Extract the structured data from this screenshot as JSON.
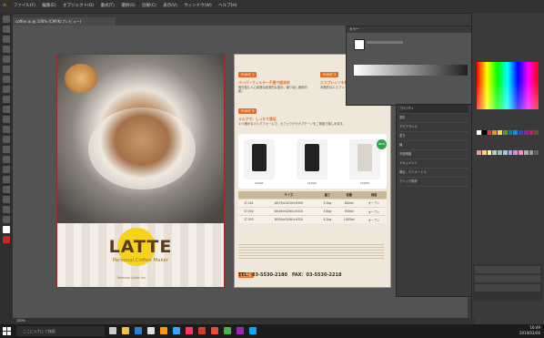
{
  "menubar": {
    "items": [
      "ファイル(F)",
      "編集(E)",
      "オブジェクト(O)",
      "書式(T)",
      "選択(S)",
      "効果(C)",
      "表示(V)",
      "ウィンドウ(W)",
      "ヘルプ(H)"
    ]
  },
  "document": {
    "tab_label": "coffee.ai @ 100% (CMYK/プレビュー)"
  },
  "page1": {
    "title": "LATTE",
    "subtitle": "Personal Coffee Maker",
    "brand": "Maebon Latte Inc."
  },
  "page2": {
    "point1_tag": "POINT 1",
    "point1_head": "ペーパーフィルター不要で経済的",
    "point1_text": "毎日飲む人に最適な経済的な設計。繰り返し使用可能。",
    "point2_tag": "POINT 2",
    "point2_head": "エスプレッソも簡単",
    "point2_text": "本格的なエスプレッソを楽しめます。",
    "point3_tag": "POINT 3",
    "point3_head": "ミルクで、しっかり満足",
    "point3_text": "キメ細かなミルクフォームで、カフェラテやカプチーノをご家庭で楽しめます。",
    "lineup_tag": "Lineup",
    "new_badge": "NEW",
    "machines": [
      "LT-001",
      "LT-002",
      "LT-003"
    ],
    "spec_headers": [
      "",
      "サイズ",
      "重さ",
      "容量",
      "価格"
    ],
    "spec_rows": [
      [
        "LT-001",
        "W170×D250×H300",
        "3.5kg",
        "800ml",
        "オープン"
      ],
      [
        "LT-002",
        "W180×D260×H310",
        "3.8kg",
        "900ml",
        "オープン"
      ],
      [
        "LT-003",
        "W200×D280×H320",
        "4.2kg",
        "1000ml",
        "オープン"
      ]
    ],
    "notes_tag": "注意事項",
    "contact_tag": "販売元",
    "tel": "TEL：03-5530-2180　FAX：03-5530-2218"
  },
  "color_picker": {
    "title": "カラー"
  },
  "properties": {
    "title": "プロパティ",
    "rows": [
      "変形",
      "アピアランス",
      "塗り",
      "線",
      "不透明度",
      "ドキュメント",
      "単位：ミリメートル",
      "クイック操作"
    ]
  },
  "status": {
    "zoom": "100%"
  },
  "taskbar": {
    "search_placeholder": "ここに入力して検索",
    "time": "16:49",
    "date": "2019/03/06"
  },
  "swatch_colors": [
    "#ffffff",
    "#000000",
    "#e53935",
    "#fb8c00",
    "#fdd835",
    "#43a047",
    "#00897b",
    "#1e88e5",
    "#3949ab",
    "#8e24aa",
    "#d81b60",
    "#6d4c41",
    "#ef9a9a",
    "#ffcc80",
    "#fff59d",
    "#a5d6a7",
    "#80cbc4",
    "#90caf9",
    "#9fa8da",
    "#ce93d8",
    "#f48fb1",
    "#bcaaa4",
    "#9e9e9e",
    "#616161"
  ]
}
